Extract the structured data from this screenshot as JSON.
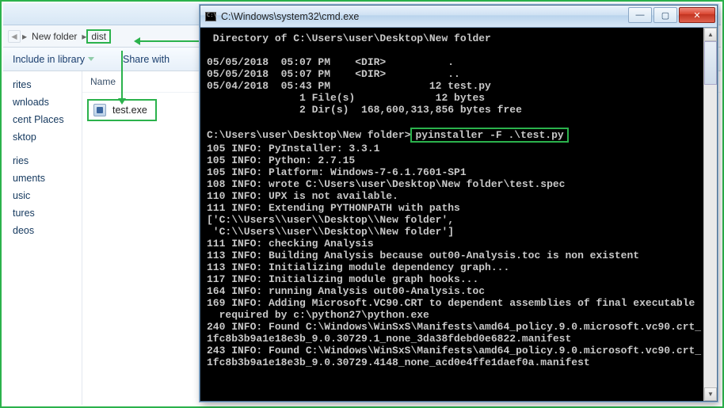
{
  "explorer": {
    "breadcrumb": {
      "root_sep": "▸",
      "seg1": "New folder",
      "seg2": "dist"
    },
    "toolbar": {
      "include": "Include in library",
      "share": "Share with"
    },
    "sidebar": [
      "rites",
      "wnloads",
      "cent Places",
      "sktop",
      "",
      "ries",
      "uments",
      "usic",
      "tures",
      "deos"
    ],
    "list": {
      "col": "Name",
      "file": "test.exe"
    }
  },
  "cmd": {
    "title": "C:\\Windows\\system32\\cmd.exe",
    "lines": {
      "dirhdr": " Directory of C:\\Users\\user\\Desktop\\New folder",
      "l1": "05/05/2018  05:07 PM    <DIR>          .",
      "l2": "05/05/2018  05:07 PM    <DIR>          ..",
      "l3": "05/04/2018  05:43 PM                12 test.py",
      "l4": "               1 File(s)             12 bytes",
      "l5": "               2 Dir(s)  168,600,313,856 bytes free",
      "prompt": "C:\\Users\\user\\Desktop\\New folder>",
      "cmdline": "pyinstaller -F .\\test.py",
      "o1": "105 INFO: PyInstaller: 3.3.1",
      "o2": "105 INFO: Python: 2.7.15",
      "o3": "105 INFO: Platform: Windows-7-6.1.7601-SP1",
      "o4": "108 INFO: wrote C:\\Users\\user\\Desktop\\New folder\\test.spec",
      "o5": "110 INFO: UPX is not available.",
      "o6": "111 INFO: Extending PYTHONPATH with paths",
      "o7": "['C:\\\\Users\\\\user\\\\Desktop\\\\New folder',",
      "o8": " 'C:\\\\Users\\\\user\\\\Desktop\\\\New folder']",
      "o9": "111 INFO: checking Analysis",
      "o10": "113 INFO: Building Analysis because out00-Analysis.toc is non existent",
      "o11": "113 INFO: Initializing module dependency graph...",
      "o12": "117 INFO: Initializing module graph hooks...",
      "o13": "164 INFO: running Analysis out00-Analysis.toc",
      "o14": "169 INFO: Adding Microsoft.VC90.CRT to dependent assemblies of final executable",
      "o15": "  required by c:\\python27\\python.exe",
      "o16": "240 INFO: Found C:\\Windows\\WinSxS\\Manifests\\amd64_policy.9.0.microsoft.vc90.crt_",
      "o17": "1fc8b3b9a1e18e3b_9.0.30729.1_none_3da38fdebd0e6822.manifest",
      "o18": "243 INFO: Found C:\\Windows\\WinSxS\\Manifests\\amd64_policy.9.0.microsoft.vc90.crt_",
      "o19": "1fc8b3b9a1e18e3b_9.0.30729.4148_none_acd0e4ffe1daef0a.manifest"
    },
    "btns": {
      "min": "—",
      "max": "▢",
      "close": "✕"
    }
  }
}
